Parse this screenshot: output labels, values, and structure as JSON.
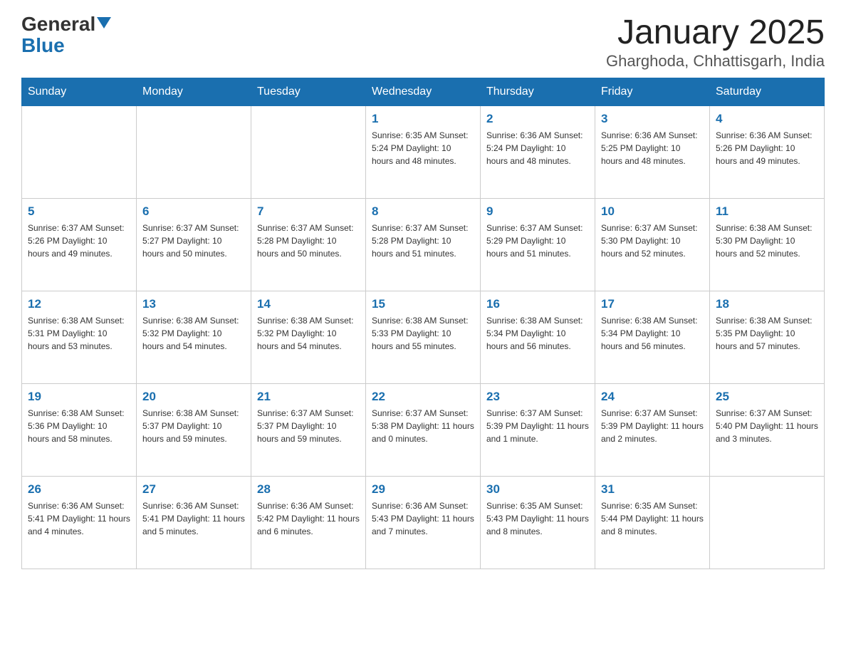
{
  "header": {
    "logo_general": "General",
    "logo_blue": "Blue",
    "title": "January 2025",
    "subtitle": "Gharghoda, Chhattisgarh, India"
  },
  "days_of_week": [
    "Sunday",
    "Monday",
    "Tuesday",
    "Wednesday",
    "Thursday",
    "Friday",
    "Saturday"
  ],
  "weeks": [
    [
      {
        "number": "",
        "info": ""
      },
      {
        "number": "",
        "info": ""
      },
      {
        "number": "",
        "info": ""
      },
      {
        "number": "1",
        "info": "Sunrise: 6:35 AM\nSunset: 5:24 PM\nDaylight: 10 hours\nand 48 minutes."
      },
      {
        "number": "2",
        "info": "Sunrise: 6:36 AM\nSunset: 5:24 PM\nDaylight: 10 hours\nand 48 minutes."
      },
      {
        "number": "3",
        "info": "Sunrise: 6:36 AM\nSunset: 5:25 PM\nDaylight: 10 hours\nand 48 minutes."
      },
      {
        "number": "4",
        "info": "Sunrise: 6:36 AM\nSunset: 5:26 PM\nDaylight: 10 hours\nand 49 minutes."
      }
    ],
    [
      {
        "number": "5",
        "info": "Sunrise: 6:37 AM\nSunset: 5:26 PM\nDaylight: 10 hours\nand 49 minutes."
      },
      {
        "number": "6",
        "info": "Sunrise: 6:37 AM\nSunset: 5:27 PM\nDaylight: 10 hours\nand 50 minutes."
      },
      {
        "number": "7",
        "info": "Sunrise: 6:37 AM\nSunset: 5:28 PM\nDaylight: 10 hours\nand 50 minutes."
      },
      {
        "number": "8",
        "info": "Sunrise: 6:37 AM\nSunset: 5:28 PM\nDaylight: 10 hours\nand 51 minutes."
      },
      {
        "number": "9",
        "info": "Sunrise: 6:37 AM\nSunset: 5:29 PM\nDaylight: 10 hours\nand 51 minutes."
      },
      {
        "number": "10",
        "info": "Sunrise: 6:37 AM\nSunset: 5:30 PM\nDaylight: 10 hours\nand 52 minutes."
      },
      {
        "number": "11",
        "info": "Sunrise: 6:38 AM\nSunset: 5:30 PM\nDaylight: 10 hours\nand 52 minutes."
      }
    ],
    [
      {
        "number": "12",
        "info": "Sunrise: 6:38 AM\nSunset: 5:31 PM\nDaylight: 10 hours\nand 53 minutes."
      },
      {
        "number": "13",
        "info": "Sunrise: 6:38 AM\nSunset: 5:32 PM\nDaylight: 10 hours\nand 54 minutes."
      },
      {
        "number": "14",
        "info": "Sunrise: 6:38 AM\nSunset: 5:32 PM\nDaylight: 10 hours\nand 54 minutes."
      },
      {
        "number": "15",
        "info": "Sunrise: 6:38 AM\nSunset: 5:33 PM\nDaylight: 10 hours\nand 55 minutes."
      },
      {
        "number": "16",
        "info": "Sunrise: 6:38 AM\nSunset: 5:34 PM\nDaylight: 10 hours\nand 56 minutes."
      },
      {
        "number": "17",
        "info": "Sunrise: 6:38 AM\nSunset: 5:34 PM\nDaylight: 10 hours\nand 56 minutes."
      },
      {
        "number": "18",
        "info": "Sunrise: 6:38 AM\nSunset: 5:35 PM\nDaylight: 10 hours\nand 57 minutes."
      }
    ],
    [
      {
        "number": "19",
        "info": "Sunrise: 6:38 AM\nSunset: 5:36 PM\nDaylight: 10 hours\nand 58 minutes."
      },
      {
        "number": "20",
        "info": "Sunrise: 6:38 AM\nSunset: 5:37 PM\nDaylight: 10 hours\nand 59 minutes."
      },
      {
        "number": "21",
        "info": "Sunrise: 6:37 AM\nSunset: 5:37 PM\nDaylight: 10 hours\nand 59 minutes."
      },
      {
        "number": "22",
        "info": "Sunrise: 6:37 AM\nSunset: 5:38 PM\nDaylight: 11 hours\nand 0 minutes."
      },
      {
        "number": "23",
        "info": "Sunrise: 6:37 AM\nSunset: 5:39 PM\nDaylight: 11 hours\nand 1 minute."
      },
      {
        "number": "24",
        "info": "Sunrise: 6:37 AM\nSunset: 5:39 PM\nDaylight: 11 hours\nand 2 minutes."
      },
      {
        "number": "25",
        "info": "Sunrise: 6:37 AM\nSunset: 5:40 PM\nDaylight: 11 hours\nand 3 minutes."
      }
    ],
    [
      {
        "number": "26",
        "info": "Sunrise: 6:36 AM\nSunset: 5:41 PM\nDaylight: 11 hours\nand 4 minutes."
      },
      {
        "number": "27",
        "info": "Sunrise: 6:36 AM\nSunset: 5:41 PM\nDaylight: 11 hours\nand 5 minutes."
      },
      {
        "number": "28",
        "info": "Sunrise: 6:36 AM\nSunset: 5:42 PM\nDaylight: 11 hours\nand 6 minutes."
      },
      {
        "number": "29",
        "info": "Sunrise: 6:36 AM\nSunset: 5:43 PM\nDaylight: 11 hours\nand 7 minutes."
      },
      {
        "number": "30",
        "info": "Sunrise: 6:35 AM\nSunset: 5:43 PM\nDaylight: 11 hours\nand 8 minutes."
      },
      {
        "number": "31",
        "info": "Sunrise: 6:35 AM\nSunset: 5:44 PM\nDaylight: 11 hours\nand 8 minutes."
      },
      {
        "number": "",
        "info": ""
      }
    ]
  ]
}
